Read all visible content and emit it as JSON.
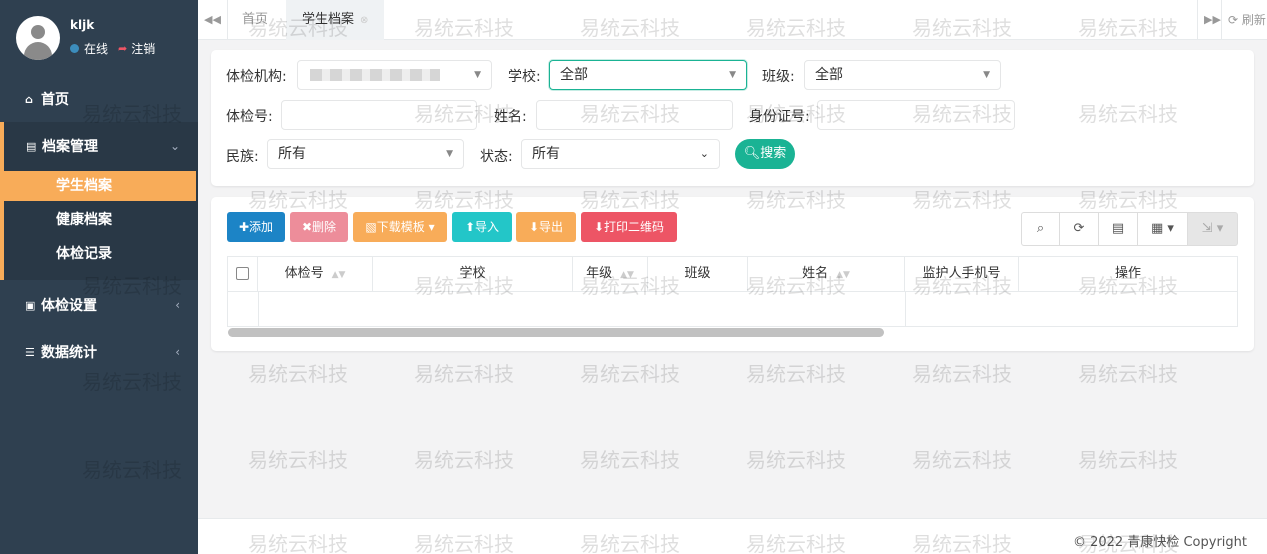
{
  "sidebar": {
    "user_name": "kljk",
    "status": "在线",
    "logout": "注销",
    "menu": [
      {
        "label": "首页",
        "icon": "home-icon"
      },
      {
        "label": "档案管理",
        "icon": "id-card-icon"
      },
      {
        "label": "体检设置",
        "icon": "desktop-icon"
      },
      {
        "label": "数据统计",
        "icon": "database-icon"
      }
    ],
    "submenu": [
      "学生档案",
      "健康档案",
      "体检记录"
    ]
  },
  "tabbar": {
    "tabs": [
      "首页",
      "学生档案"
    ],
    "refresh": "刷新"
  },
  "search": {
    "org_label": "体检机构:",
    "school_label": "学校:",
    "school_value": "全部",
    "class_label": "班级:",
    "class_value": "全部",
    "exam_no_label": "体检号:",
    "name_label": "姓名:",
    "id_label": "身份证号:",
    "ethnic_label": "民族:",
    "ethnic_value": "所有",
    "state_label": "状态:",
    "state_value": "所有",
    "search_button": "搜索"
  },
  "toolbar": {
    "add": "添加",
    "delete": "删除",
    "download_template": "下载模板",
    "import": "导入",
    "export": "导出",
    "print_qr": "打印二维码"
  },
  "table": {
    "columns": [
      "体检号",
      "学校",
      "年级",
      "班级",
      "姓名",
      "监护人手机号",
      "操作"
    ]
  },
  "footer": {
    "copyright": "© 2022 青康快检 Copyright"
  },
  "watermark": "易统云科技",
  "colors": {
    "sidebar_bg": "#2f4050",
    "accent_orange": "#f8ac59",
    "primary_blue": "#1c84c6",
    "danger_pink": "#ed8d9a",
    "info_teal": "#23c6c8",
    "print_red": "#ed5565",
    "search_green": "#1ab394"
  }
}
